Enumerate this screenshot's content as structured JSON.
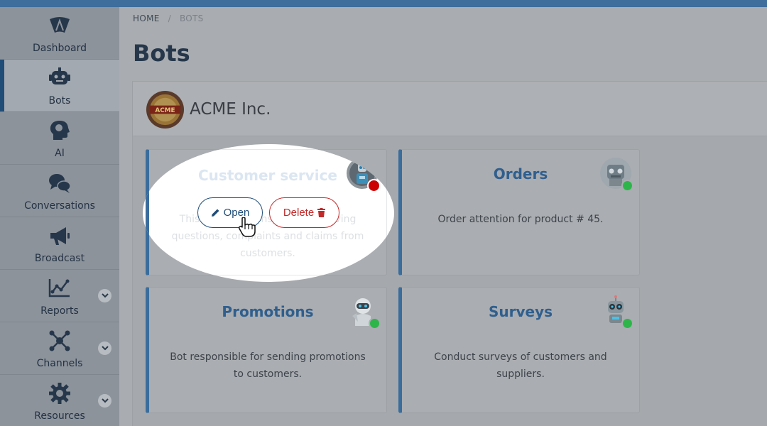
{
  "sidebar": {
    "items": [
      {
        "label": "Dashboard",
        "icon": "dashboard-gauge-icon",
        "active": false
      },
      {
        "label": "Bots",
        "icon": "robot-icon",
        "active": true
      },
      {
        "label": "AI",
        "icon": "head-brain-icon",
        "active": false
      },
      {
        "label": "Conversations",
        "icon": "chat-bubbles-icon",
        "active": false
      },
      {
        "label": "Broadcast",
        "icon": "megaphone-icon",
        "active": false
      },
      {
        "label": "Reports",
        "icon": "chart-line-icon",
        "active": false,
        "expandable": true
      },
      {
        "label": "Channels",
        "icon": "network-hub-icon",
        "active": false,
        "expandable": true
      },
      {
        "label": "Resources",
        "icon": "gear-icon",
        "active": false,
        "expandable": true
      }
    ]
  },
  "breadcrumb": {
    "home": "HOME",
    "separator": "/",
    "current": "BOTS"
  },
  "page": {
    "title": "Bots"
  },
  "company": {
    "name": "ACME Inc.",
    "logo_text": "ACME"
  },
  "cards": [
    {
      "title": "Customer service",
      "description": "This bot is responsible for receiving questions, complaints and claims from customers.",
      "status": "offline",
      "status_color": "#c00000"
    },
    {
      "title": "Orders",
      "description": "Order attention for product # 45.",
      "status": "online",
      "status_color": "#2db54a"
    },
    {
      "title": "Promotions",
      "description": "Bot responsible for sending promotions to customers.",
      "status": "online",
      "status_color": "#2db54a"
    },
    {
      "title": "Surveys",
      "description": "Conduct surveys of customers and suppliers.",
      "status": "online",
      "status_color": "#2db54a"
    }
  ],
  "actions": {
    "open_label": "Open",
    "delete_label": "Delete"
  },
  "colors": {
    "accent": "#3a6d9c",
    "title_blue": "#2f5f8e",
    "danger": "#c22a2a",
    "online": "#2db54a",
    "offline": "#c00000"
  }
}
